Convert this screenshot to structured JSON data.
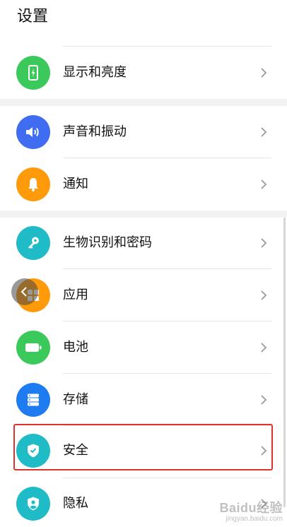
{
  "header": {
    "title": "设置"
  },
  "rows": [
    {
      "label": "显示和亮度",
      "icon": "phone-icon",
      "color": "#3cc95b"
    },
    {
      "label": "声音和振动",
      "icon": "speaker-icon",
      "color": "#3f6cf0"
    },
    {
      "label": "通知",
      "icon": "bell-icon",
      "color": "#ff9a0a"
    },
    {
      "label": "生物识别和密码",
      "icon": "key-icon",
      "color": "#1fbcc8"
    },
    {
      "label": "应用",
      "icon": "apps-icon",
      "color": "#ff9a0a"
    },
    {
      "label": "电池",
      "icon": "battery-icon",
      "color": "#3cc95b"
    },
    {
      "label": "存储",
      "icon": "storage-icon",
      "color": "#1f7cf0"
    },
    {
      "label": "安全",
      "icon": "shield-icon",
      "color": "#1fbcc8"
    },
    {
      "label": "隐私",
      "icon": "privacy-icon",
      "color": "#1fbcc8"
    }
  ],
  "watermark": {
    "main": "Baidu经验",
    "sub": "jingyan.baidu.com"
  },
  "accent": {
    "highlight": "#e03131"
  }
}
